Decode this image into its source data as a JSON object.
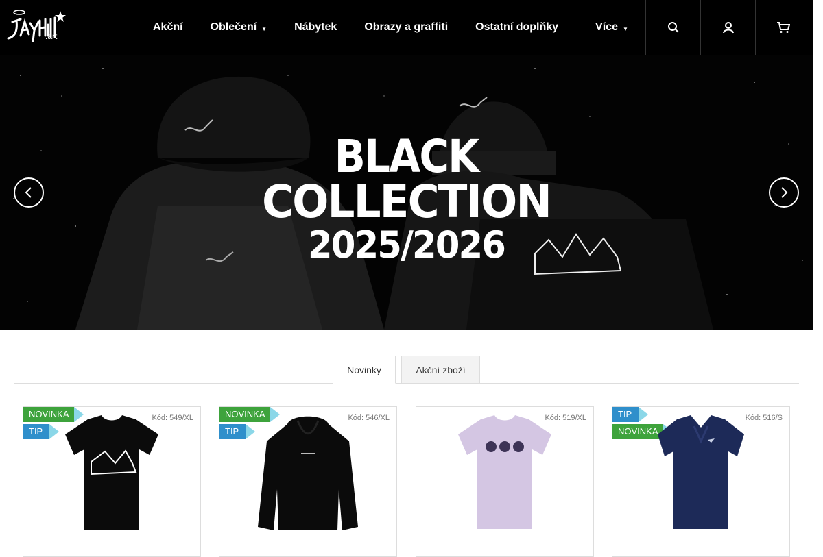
{
  "header": {
    "logo_text": "JAYHILL",
    "logo_sub": ".art",
    "nav": [
      {
        "label": "Akční",
        "has_caret": false
      },
      {
        "label": "Oblečení",
        "has_caret": true
      },
      {
        "label": "Nábytek",
        "has_caret": false
      },
      {
        "label": "Obrazy a graffiti",
        "has_caret": false
      },
      {
        "label": "Ostatní doplňky",
        "has_caret": false
      },
      {
        "label": "Více",
        "has_caret": true
      }
    ],
    "icons": [
      "search-icon",
      "user-icon",
      "cart-icon"
    ]
  },
  "hero": {
    "line1": "BLACK",
    "line2": "COLLECTION",
    "line3": "2025/2026",
    "prev_icon": "chevron-left-icon",
    "next_icon": "chevron-right-icon"
  },
  "tabs": [
    {
      "label": "Novinky",
      "active": true
    },
    {
      "label": "Akční zboží",
      "active": false
    }
  ],
  "products": [
    {
      "code": "Kód: 549/XL",
      "flags": [
        "NOVINKA",
        "TIP"
      ],
      "item": "tshirt",
      "color": "#0b0b0b"
    },
    {
      "code": "Kód: 546/XL",
      "flags": [
        "NOVINKA",
        "TIP"
      ],
      "item": "hoodie",
      "color": "#0b0b0b"
    },
    {
      "code": "Kód: 519/XL",
      "flags": [],
      "item": "tshirt",
      "color": "#d4c6e3"
    },
    {
      "code": "Kód: 516/S",
      "flags": [
        "TIP",
        "NOVINKA"
      ],
      "item": "polo",
      "color": "#1d2a58"
    }
  ],
  "colors": {
    "novinka": "#3ea33c",
    "tip": "#2f8fcb",
    "header_bg": "#000000"
  }
}
